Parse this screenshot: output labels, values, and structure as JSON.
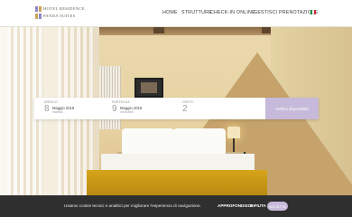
{
  "header": {
    "logo_lines": [
      "HOTEL RESIDENCE",
      "PANDA SUITES"
    ],
    "menu": [
      {
        "label": "HOME"
      },
      {
        "label": "STRUTTURE"
      },
      {
        "label": "CHECK-IN ONLINE"
      },
      {
        "label": "GESTISCI PRENOTAZIONE"
      }
    ],
    "language_flag": "it-flag-icon",
    "flag_colors": [
      "#009246",
      "#ffffff",
      "#ce2b37"
    ]
  },
  "booking": {
    "arrival": {
      "label": "ARRIVO",
      "day": "8",
      "month": "Maggio 2018",
      "weekday": "martedì"
    },
    "departure": {
      "label": "PARTENZA",
      "day": "9",
      "month": "Maggio 2018",
      "weekday": "mercoledì"
    },
    "guests": {
      "label": "OSPITI",
      "count": "2"
    },
    "verify_label": "Verifica disponibilità"
  },
  "cookie_bar": {
    "text": "Usiamo cookie tecnici e analitici per migliorare l'esperienza di navigazione.",
    "details_label": "APPROFONDISCI",
    "reject_label": "RIFIUTA",
    "accept_label": "ACCETTA"
  },
  "colors": {
    "accent": "#c6b9d9",
    "logo_purple": "#8f86c4",
    "logo_gold": "#c9a45a"
  }
}
